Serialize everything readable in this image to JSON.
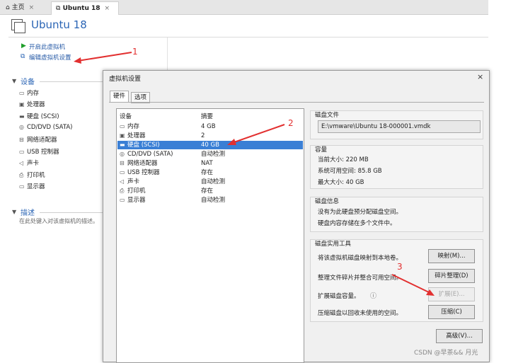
{
  "tabs": [
    {
      "label": "主页"
    },
    {
      "label": "Ubuntu 18"
    }
  ],
  "vm": {
    "title": "Ubuntu 18"
  },
  "actions": {
    "power_on": "开启此虚拟机",
    "edit_settings": "编辑虚拟机设置"
  },
  "devices_section": {
    "title": "设备",
    "items": [
      {
        "label": "内存",
        "icon": "memory-icon"
      },
      {
        "label": "处理器",
        "icon": "cpu-icon"
      },
      {
        "label": "硬盘 (SCSI)",
        "icon": "disk-icon"
      },
      {
        "label": "CD/DVD (SATA)",
        "icon": "cdrom-icon"
      },
      {
        "label": "网络适配器",
        "icon": "network-icon"
      },
      {
        "label": "USB 控制器",
        "icon": "usb-icon"
      },
      {
        "label": "声卡",
        "icon": "speaker-icon"
      },
      {
        "label": "打印机",
        "icon": "printer-icon"
      },
      {
        "label": "显示器",
        "icon": "monitor-icon"
      }
    ]
  },
  "desc_section": {
    "title": "描述",
    "placeholder": "在此处键入对该虚拟机的描述。"
  },
  "dialog": {
    "title": "虚拟机设置",
    "tabs": [
      "硬件",
      "选项"
    ],
    "list": {
      "header": {
        "device": "设备",
        "summary": "摘要"
      },
      "rows": [
        {
          "device": "内存",
          "summary": "4 GB",
          "icon": "memory-icon"
        },
        {
          "device": "处理器",
          "summary": "2",
          "icon": "cpu-icon"
        },
        {
          "device": "硬盘 (SCSI)",
          "summary": "40 GB",
          "icon": "disk-icon",
          "selected": true
        },
        {
          "device": "CD/DVD (SATA)",
          "summary": "自动检测",
          "icon": "cdrom-icon"
        },
        {
          "device": "网络适配器",
          "summary": "NAT",
          "icon": "network-icon"
        },
        {
          "device": "USB 控制器",
          "summary": "存在",
          "icon": "usb-icon"
        },
        {
          "device": "声卡",
          "summary": "自动检测",
          "icon": "speaker-icon"
        },
        {
          "device": "打印机",
          "summary": "存在",
          "icon": "printer-icon"
        },
        {
          "device": "显示器",
          "summary": "自动检测",
          "icon": "monitor-icon"
        }
      ]
    },
    "disk_file": {
      "title": "磁盘文件",
      "path": "E:\\vmware\\Ubuntu 18-000001.vmdk"
    },
    "capacity": {
      "title": "容量",
      "current": "当前大小: 220 MB",
      "available": "系统可用空间: 85.8 GB",
      "max": "最大大小: 40 GB"
    },
    "disk_info": {
      "title": "磁盘信息",
      "line1": "没有为此硬盘预分配磁盘空间。",
      "line2": "硬盘内容存储在多个文件中。"
    },
    "utilities": {
      "title": "磁盘实用工具",
      "map_text": "将该虚拟机磁盘映射到本地卷。",
      "map_btn": "映射(M)...",
      "defrag_text": "整理文件碎片并整合可用空间。",
      "defrag_btn": "碎片整理(D)",
      "expand_text": "扩展磁盘容量。",
      "expand_btn": "扩展(E)...",
      "compact_text": "压缩磁盘以回收未使用的空间。",
      "compact_btn": "压缩(C)"
    },
    "advanced_btn": "高级(V)..."
  },
  "annotations": [
    "1",
    "2",
    "3"
  ],
  "watermark": "CSDN @早茶&& 月光",
  "colors": {
    "accent": "#2b65b5",
    "annotation": "#e23030",
    "selection": "#3a7fd5"
  }
}
